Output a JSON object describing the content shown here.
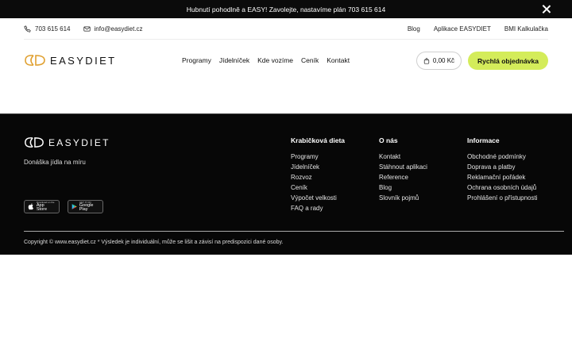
{
  "promo": {
    "text": "Hubnutí pohodlně a EASY! Zavolejte, nastavíme plán 703 615 614"
  },
  "contact": {
    "phone": "703 615 614",
    "email": "info@easydiet.cz"
  },
  "top_links": [
    "Blog",
    "Aplikace EASYDIET",
    "BMI Kalkulačka"
  ],
  "brand": {
    "name": "EASYDIET",
    "accent": "#d4ec5a",
    "logo_color": "#e0a030"
  },
  "nav": [
    "Programy",
    "Jídelníček",
    "Kde vozíme",
    "Ceník",
    "Kontakt"
  ],
  "cart": {
    "total": "0,00 Kč"
  },
  "order_button": "Rychlá objednávka",
  "footer": {
    "tagline": "Donáška jídla na míru",
    "stores": [
      {
        "small": "Download on the",
        "big": "App Store",
        "icon": "apple-icon"
      },
      {
        "small": "GET IT ON",
        "big": "Google Play",
        "icon": "google-play-icon"
      }
    ],
    "columns": [
      {
        "title": "Krabičková dieta",
        "items": [
          "Programy",
          "Jídelníček",
          "Rozvoz",
          "Ceník",
          "Výpočet velkosti",
          "FAQ a rady"
        ]
      },
      {
        "title": "O nás",
        "items": [
          "Kontakt",
          "Stáhnout aplikaci",
          "Reference",
          "Blog",
          "Slovník pojmů"
        ]
      },
      {
        "title": "Informace",
        "items": [
          "Obchodné podmínky",
          "Doprava a platby",
          "Reklamační pořádek",
          "Ochrana osobních údajů",
          "Prohlášení o přístupnosti"
        ]
      }
    ],
    "copyright": "Copyright © www.easydiet.cz * Výsledek je individuální, může se lišit a závisí na predispozici dané osoby."
  }
}
